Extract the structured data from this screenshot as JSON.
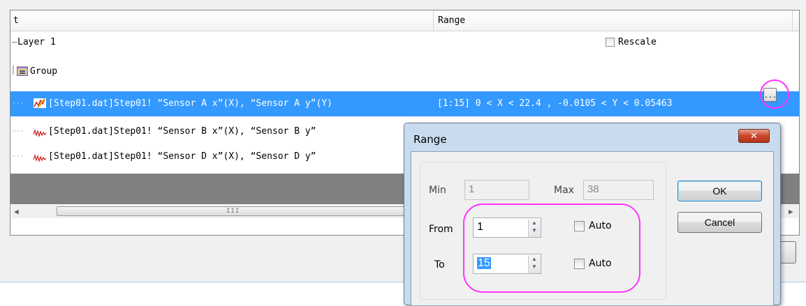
{
  "tree": {
    "header_col1": "t",
    "header_col2": "Range",
    "layer_label": "Layer 1",
    "rescale_label": "Rescale",
    "group_label": "Group",
    "rows": [
      {
        "text": "[Step01.dat]Step01! “Sensor A x”(X), “Sensor A y”(Y)",
        "range": "[1:15]  0 < X < 22.4 , -0.0105 < Y < 0.05463"
      },
      {
        "text": "[Step01.dat]Step01! “Sensor B x”(X), “Sensor B y”"
      },
      {
        "text": "[Step01.dat]Step01! “Sensor D x”(X), “Sensor D y”"
      }
    ],
    "ellipsis_label": "...",
    "scroll_grip": "III"
  },
  "dialog": {
    "title": "Range",
    "close_glyph": "✕",
    "min_label": "Min",
    "min_value": "1",
    "max_label": "Max",
    "max_value": "38",
    "from_label": "From",
    "from_value": "1",
    "to_label": "To",
    "to_value": "15",
    "auto_label": "Auto",
    "ok_label": "OK",
    "cancel_label": "Cancel"
  },
  "colors": {
    "selection": "#3399ff",
    "highlight": "#ff33ff",
    "close_button": "#c9452b"
  }
}
